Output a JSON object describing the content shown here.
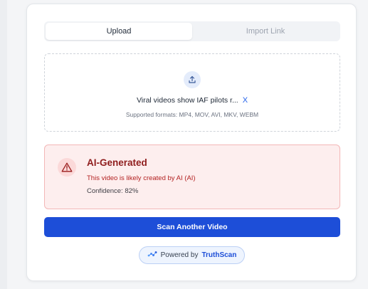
{
  "tabs": [
    {
      "label": "Upload",
      "active": true
    },
    {
      "label": "Import Link",
      "active": false
    }
  ],
  "upload": {
    "icon": "upload-icon",
    "file_name": "Viral videos show IAF pilots r...",
    "remove_label": "X",
    "supported_formats": "Supported formats: MP4, MOV, AVI, MKV, WEBM"
  },
  "result": {
    "icon": "warning-triangle-icon",
    "title": "AI-Generated",
    "description": "This video is likely created by AI (AI)",
    "confidence": "Confidence: 82%",
    "colors": {
      "background": "#fdeeee",
      "border": "#f3b7b7",
      "title": "#8f1d1d",
      "text": "#b42323"
    }
  },
  "actions": {
    "scan_another": "Scan Another Video"
  },
  "footer": {
    "powered_by": "Powered by",
    "brand": "TruthScan",
    "icon": "truthscan-logo-icon"
  },
  "colors": {
    "primary": "#1d4ed8",
    "accent": "#2563eb"
  }
}
